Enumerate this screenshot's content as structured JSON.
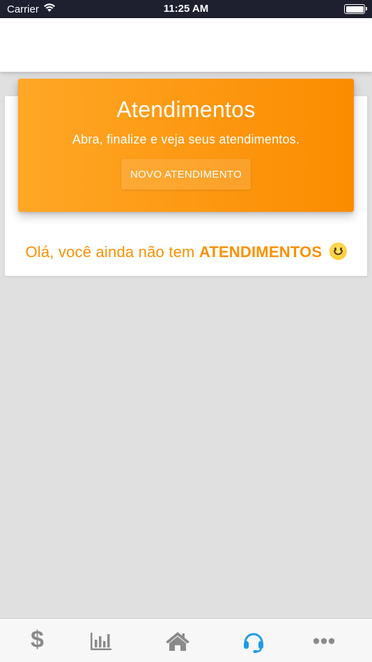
{
  "status_bar": {
    "carrier": "Carrier",
    "time": "11:25 AM"
  },
  "banner": {
    "title": "Atendimentos",
    "subtitle": "Abra, finalize e veja seus atendimentos.",
    "button_label": "NOVO ATENDIMENTO"
  },
  "empty_state": {
    "prefix": "Olá, você ainda não tem ",
    "highlight": "ATENDIMENTOS"
  },
  "tab_bar": {
    "active_index": 3,
    "items": [
      {
        "icon": "dollar-icon",
        "label": "$"
      },
      {
        "icon": "bar-chart-icon"
      },
      {
        "icon": "home-icon"
      },
      {
        "icon": "headset-icon"
      },
      {
        "icon": "more-icon"
      }
    ]
  },
  "colors": {
    "accent": "#fb8c00",
    "tab_active": "#1e9be6",
    "tab_inactive": "#8a8a8a",
    "status_bar_bg": "#1e2030"
  }
}
